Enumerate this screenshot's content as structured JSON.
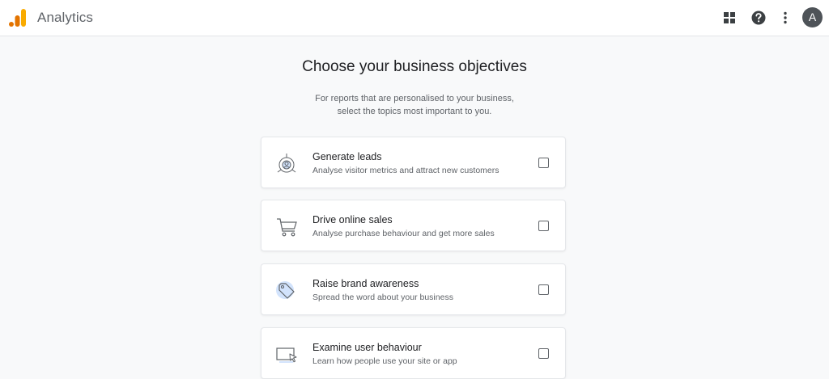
{
  "header": {
    "app_name": "Analytics",
    "avatar_letter": "A",
    "icons": [
      "analytics-logo-icon",
      "apps-grid-icon",
      "help-icon",
      "more-vert-icon"
    ]
  },
  "main": {
    "heading": "Choose your business objectives",
    "subtext_line1": "For reports that are personalised to your business,",
    "subtext_line2": "select the topics most important to you.",
    "objectives": [
      {
        "title": "Generate leads",
        "description": "Analyse visitor metrics and attract new customers",
        "icon": "leads-target-icon",
        "checked": false
      },
      {
        "title": "Drive online sales",
        "description": "Analyse purchase behaviour and get more sales",
        "icon": "shopping-cart-icon",
        "checked": false
      },
      {
        "title": "Raise brand awareness",
        "description": "Spread the word about your business",
        "icon": "price-tag-icon",
        "checked": false
      },
      {
        "title": "Examine user behaviour",
        "description": "Learn how people use your site or app",
        "icon": "screen-cursor-icon",
        "checked": false
      }
    ]
  },
  "colors": {
    "logo_orange": "#f9ab00",
    "logo_dark_orange": "#e37400",
    "background": "#f8f9fa",
    "icon_accent": "#d2e3fc"
  }
}
